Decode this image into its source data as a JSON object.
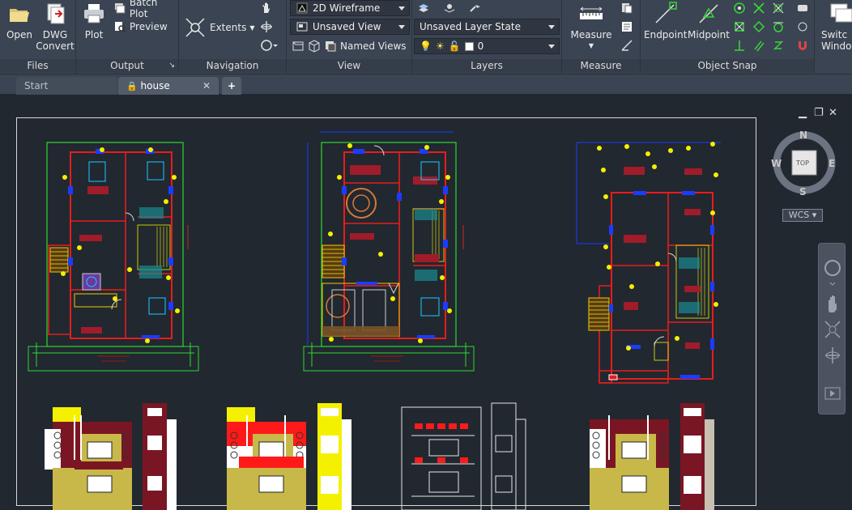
{
  "ribbon": {
    "files": {
      "title": "Files",
      "open": "Open",
      "dwg_convert_line1": "DWG",
      "dwg_convert_line2": "Convert"
    },
    "output": {
      "title": "Output",
      "plot": "Plot",
      "batch_plot": "Batch Plot",
      "preview": "Preview"
    },
    "navigation": {
      "title": "Navigation",
      "extents": "Extents"
    },
    "view": {
      "title": "View",
      "visual_style": "2D Wireframe",
      "named_view": "Unsaved View",
      "named_views": "Named Views"
    },
    "layers": {
      "title": "Layers",
      "layer_state": "Unsaved Layer State",
      "current_layer": "0"
    },
    "measure": {
      "title": "Measure",
      "measure": "Measure"
    },
    "object_snap": {
      "title": "Object Snap",
      "endpoint": "Endpoint",
      "midpoint": "Midpoint"
    },
    "switch_window": {
      "line1": "Switc",
      "line2": "Windo"
    }
  },
  "tabs": {
    "start": "Start",
    "house": "house",
    "close": "✕",
    "new": "+"
  },
  "viewcube": {
    "n": "N",
    "s": "S",
    "e": "E",
    "w": "W",
    "face": "TOP",
    "wcs": "WCS"
  },
  "colors": {
    "ribbon_bg": "#3b4452",
    "model_bg": "#212830",
    "wall_red": "#e81c1c",
    "green_boundary": "#2fd92f",
    "blue_door": "#1a3cff",
    "yellow_fixture": "#f5f000"
  }
}
